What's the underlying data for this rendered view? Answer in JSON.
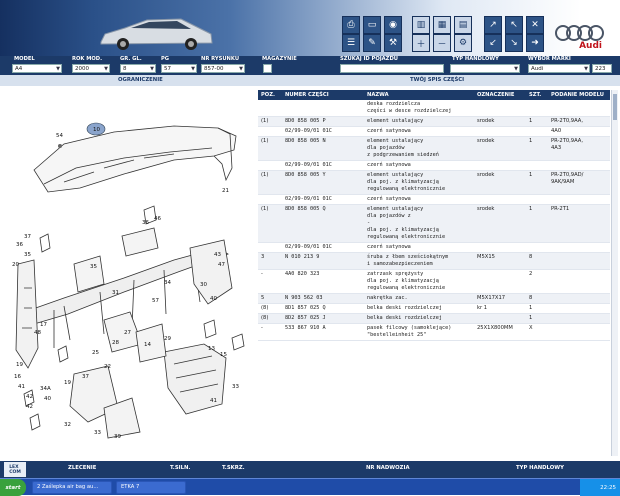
{
  "filters": {
    "model": {
      "label": "MODEL",
      "value": "A4"
    },
    "year": {
      "label": "ROK MOD.",
      "value": "2000"
    },
    "group": {
      "label": "GR. GL.",
      "value": "8"
    },
    "pg": {
      "label": "PG",
      "value": "57"
    },
    "drawing": {
      "label": "NR RYSUNKU",
      "value": "857-00"
    },
    "warehouse": {
      "label": "MAGAZYNIE"
    },
    "vin": {
      "label": "SZUKAJ ID POJAZDU",
      "value": ""
    },
    "trade_type": {
      "label": "TYP HANDLOWY",
      "value": ""
    },
    "brand": {
      "label": "WYBÓR MARKI",
      "value": "Audi",
      "code": "223"
    }
  },
  "subbar": {
    "left": "OGRANICZENIE",
    "right": "TWÓJ SPIS CZĘŚCI"
  },
  "brand_logo_text": "Audi",
  "table": {
    "headers": [
      "POZ.",
      "NUMER CZĘŚCI",
      "NAZWA",
      "OZNACZENIE",
      "SZT.",
      "PODANIE MODELU"
    ],
    "rows": [
      {
        "poz": "",
        "num": "",
        "name": "deska rozdzielcza\nczęści w desce rozdzielczej",
        "ozn": "",
        "szt": "",
        "model": ""
      },
      {
        "poz": "(1)",
        "num": "8D0 858 005 P",
        "name": "element ustalający",
        "ozn": "srodek",
        "szt": "1",
        "model": "PR-2T0,9AA,"
      },
      {
        "poz": "",
        "num": "02/99-09/01 01C",
        "name": "czerń satynowa",
        "ozn": "",
        "szt": "",
        "model": "4A0"
      },
      {
        "poz": "(1)",
        "num": "8D0 858 005 N",
        "name": "element ustalający\ndla pojazdów\nz podgrzewaniem siedzeń",
        "ozn": "srodek",
        "szt": "1",
        "model": "PR-2T0,9AA,\n4A3"
      },
      {
        "poz": "",
        "num": "02/99-09/01 01C",
        "name": "czerń satynowa",
        "ozn": "",
        "szt": "",
        "model": ""
      },
      {
        "poz": "(1)",
        "num": "8D0 858 005 Y",
        "name": "element ustalający\ndla poj. z klimatyzacją\nregulowaną elektronicznie",
        "ozn": "srodek",
        "szt": "1",
        "model": "PR-2T0,9AD/\n9AK/9AM"
      },
      {
        "poz": "",
        "num": "02/99-09/01 01C",
        "name": "czerń satynowa",
        "ozn": "",
        "szt": "",
        "model": ""
      },
      {
        "poz": "(1)",
        "num": "8D0 858 005 Q",
        "name": "element ustalający\ndla pojazdów z\n-\ndla poj. z klimatyzacją\nregulowaną elektronicznie",
        "ozn": "srodek",
        "szt": "1",
        "model": "PR-2T1"
      },
      {
        "poz": "",
        "num": "02/99-09/01 01C",
        "name": "czerń satynowa",
        "ozn": "",
        "szt": "",
        "model": ""
      },
      {
        "poz": "3",
        "num": "N 010 213 9",
        "name": "śruba z łbem sześciokątnym\ni samozabezpieczeniem",
        "ozn": "M5X15",
        "szt": "8",
        "model": ""
      },
      {
        "poz": "-",
        "num": "4A0 820 323",
        "name": "zatrzask sprężysty\ndla poj. z klimatyzacją\nregulowaną elektronicznie",
        "ozn": "",
        "szt": "2",
        "model": ""
      },
      {
        "poz": "5",
        "num": "N 903 562 03",
        "name": "nakrętka zac.",
        "ozn": "M5X17X17",
        "szt": "8",
        "model": ""
      },
      {
        "poz": "(8)",
        "num": "8D1 857 025 Q",
        "name": "belka deski rozdzielczej",
        "ozn": "kr 1",
        "szt": "1",
        "model": ""
      },
      {
        "poz": "(8)",
        "num": "8D2 857 025 J",
        "name": "belka deski rozdzielczej",
        "ozn": "",
        "szt": "1",
        "model": ""
      },
      {
        "poz": "-",
        "num": "533 867 910 A",
        "name": "pasek filcowy (samoklejące)\n\"bestelleinheit 25\"",
        "ozn": "25X1X800MM",
        "szt": "X",
        "model": ""
      }
    ]
  },
  "diagram_labels": [
    "54",
    "10",
    "21",
    "36",
    "35",
    "20",
    "37",
    "36",
    "46",
    "43",
    "47",
    "35",
    "40",
    "17",
    "48",
    "57",
    "31",
    "34",
    "30",
    "27",
    "28",
    "22",
    "19",
    "16",
    "41",
    "42",
    "34A",
    "40",
    "42",
    "32",
    "33",
    "39",
    "13",
    "15",
    "29",
    "14",
    "25",
    "37",
    "19",
    "41",
    "33"
  ],
  "footer": {
    "logo": "LEX\nCOM",
    "buttons": [
      "ZLECENIE",
      "T.SILN.",
      "T.SKRZ.",
      "NR NADWOZIA",
      "TYP HANDLOWY"
    ]
  },
  "taskbar": {
    "start": "start",
    "tasks": [
      "2 Zaślepka air bag au...",
      "ETKA 7"
    ],
    "clock": "22:25"
  }
}
